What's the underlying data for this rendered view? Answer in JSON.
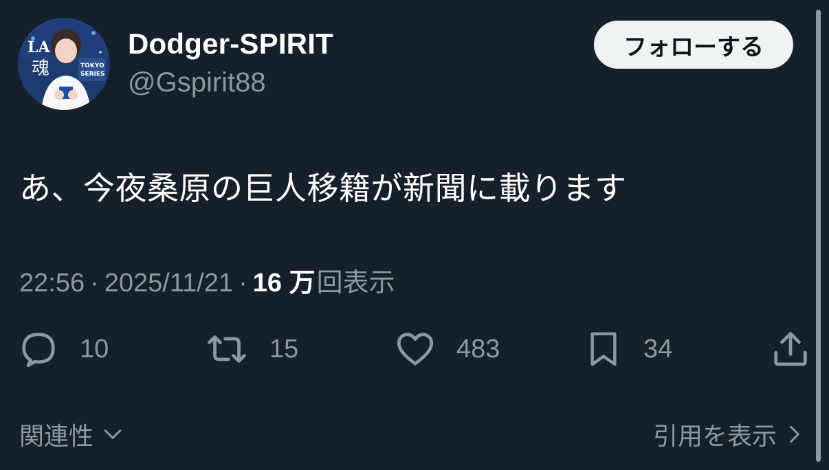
{
  "author": {
    "display_name": "Dodger-SPIRIT",
    "handle": "@Gspirit88",
    "avatar_icon": "avatar-icon"
  },
  "follow_button": {
    "label": "フォローする"
  },
  "post": {
    "text": "あ、今夜桑原の巨人移籍が新聞に載ります",
    "time": "22:56",
    "date": "2025/11/21",
    "separator": "·",
    "views_count": "16 万",
    "views_label": "回表示"
  },
  "actions": {
    "reply": {
      "icon": "reply-icon",
      "count": "10"
    },
    "repost": {
      "icon": "repost-icon",
      "count": "15"
    },
    "like": {
      "icon": "heart-icon",
      "count": "483"
    },
    "bookmark": {
      "icon": "bookmark-icon",
      "count": "34"
    },
    "share": {
      "icon": "share-icon"
    }
  },
  "footer": {
    "relevance_label": "関連性",
    "view_quotes_label": "引用を表示"
  },
  "colors": {
    "background": "#15202b",
    "primary_text": "#ffffff",
    "secondary_text": "#8b98a5",
    "follow_button_bg": "#eff3f4",
    "follow_button_text": "#0f1419"
  }
}
